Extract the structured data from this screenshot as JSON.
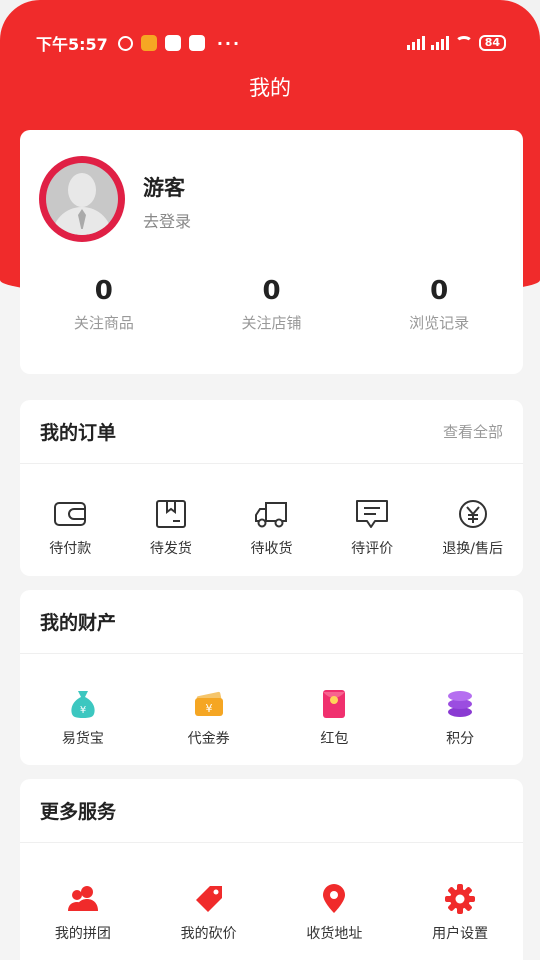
{
  "status_bar": {
    "time": "下午5:57",
    "dots": "···",
    "battery": "84"
  },
  "header": {
    "title": "我的"
  },
  "profile": {
    "name": "游客",
    "login": "去登录",
    "stats": [
      {
        "value": "0",
        "label": "关注商品"
      },
      {
        "value": "0",
        "label": "关注店铺"
      },
      {
        "value": "0",
        "label": "浏览记录"
      }
    ]
  },
  "orders": {
    "title": "我的订单",
    "view_all": "查看全部",
    "items": [
      {
        "label": "待付款",
        "icon": "wallet-icon"
      },
      {
        "label": "待发货",
        "icon": "package-icon"
      },
      {
        "label": "待收货",
        "icon": "truck-icon"
      },
      {
        "label": "待评价",
        "icon": "comment-icon"
      },
      {
        "label": "退换/售后",
        "icon": "yuan-icon"
      }
    ]
  },
  "assets": {
    "title": "我的财产",
    "items": [
      {
        "label": "易货宝",
        "icon": "money-bag-icon",
        "color": "#3cc7c0"
      },
      {
        "label": "代金券",
        "icon": "coupon-icon",
        "color": "#f5a623"
      },
      {
        "label": "红包",
        "icon": "red-envelope-icon",
        "color": "#f0306e"
      },
      {
        "label": "积分",
        "icon": "coins-icon",
        "color": "#9b4de0"
      }
    ]
  },
  "services": {
    "title": "更多服务",
    "items": [
      {
        "label": "我的拼团",
        "icon": "group-icon"
      },
      {
        "label": "我的砍价",
        "icon": "price-tag-icon"
      },
      {
        "label": "收货地址",
        "icon": "location-icon"
      },
      {
        "label": "用户设置",
        "icon": "settings-gear-icon"
      }
    ],
    "accent": "#f02b2b"
  },
  "colors": {
    "brand": "#f02b2b"
  }
}
